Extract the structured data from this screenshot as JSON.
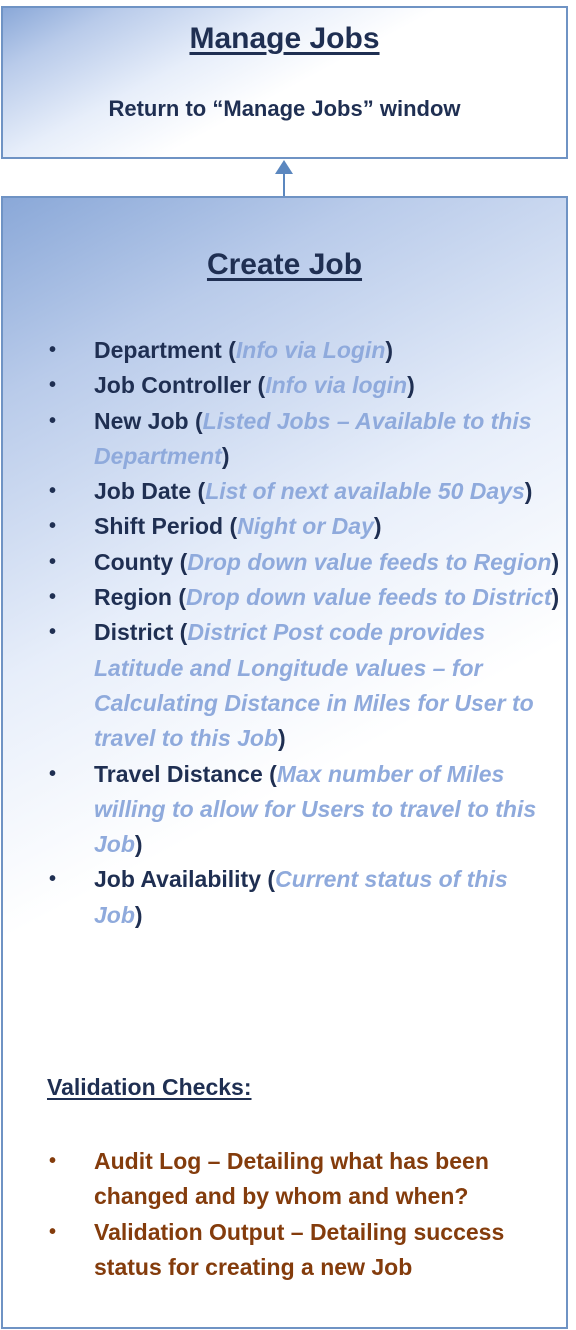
{
  "manage_jobs": {
    "title": "Manage Jobs",
    "subtitle": "Return to “Manage Jobs” window"
  },
  "create_job": {
    "title": "Create Job",
    "bullet_glyph": "•",
    "fields": [
      {
        "label": "Department",
        "hint": "Info via Login"
      },
      {
        "label": "Job Controller",
        "hint": "Info via login"
      },
      {
        "label": "New Job",
        "hint": "Listed Jobs – Available to this Department"
      },
      {
        "label": "Job Date",
        "hint": "List of next available 50 Days"
      },
      {
        "label": "Shift Period",
        "hint": "Night or Day"
      },
      {
        "label": "County",
        "hint": "Drop down value feeds to Region"
      },
      {
        "label": "Region",
        "hint": "Drop down value feeds to District"
      },
      {
        "label": "District",
        "hint": "District Post code provides Latitude and Longitude values – for Calculating Distance in Miles for User to travel to this Job"
      },
      {
        "label": "Travel Distance",
        "hint": "Max number of Miles willing to allow for Users to travel to this Job"
      },
      {
        "label": "Job Availability",
        "hint": "Current status of this Job"
      }
    ],
    "validation_heading": "Validation Checks:",
    "validation_checks": [
      "Audit Log – Detailing what has been changed and by whom and when?",
      "Validation Output – Detailing success status for creating a new Job"
    ]
  }
}
